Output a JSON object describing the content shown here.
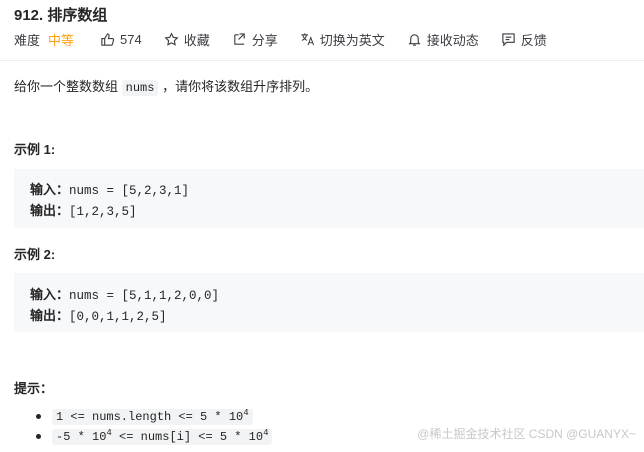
{
  "problem": {
    "title": "912. 排序数组",
    "difficulty_label": "难度",
    "difficulty": "中等",
    "likes": "574",
    "actions": {
      "favorite": "收藏",
      "share": "分享",
      "translate": "切换为英文",
      "notify": "接收动态",
      "feedback": "反馈"
    }
  },
  "description": {
    "before": "给你一个整数数组",
    "code": "nums",
    "after": "，请你将该数组升序排列。"
  },
  "examples": [
    {
      "heading": "示例 1:",
      "input_label": "输入：",
      "input_value": "nums = [5,2,3,1]",
      "output_label": "输出：",
      "output_value": "[1,2,3,5]"
    },
    {
      "heading": "示例 2:",
      "input_label": "输入：",
      "input_value": "nums = [5,1,1,2,0,0]",
      "output_label": "输出：",
      "output_value": "[0,0,1,1,2,5]"
    }
  ],
  "hints": {
    "heading": "提示：",
    "items": [
      {
        "pre": "1 <= nums.length <= 5 * 10",
        "exp": "4",
        "post": ""
      },
      {
        "pre": "-5 * 10",
        "exp": "4",
        "post": " <= nums[i] <= 5 * 10",
        "exp2": "4"
      }
    ]
  },
  "watermark": "@稀土掘金技术社区 CSDN @GUANYX~"
}
